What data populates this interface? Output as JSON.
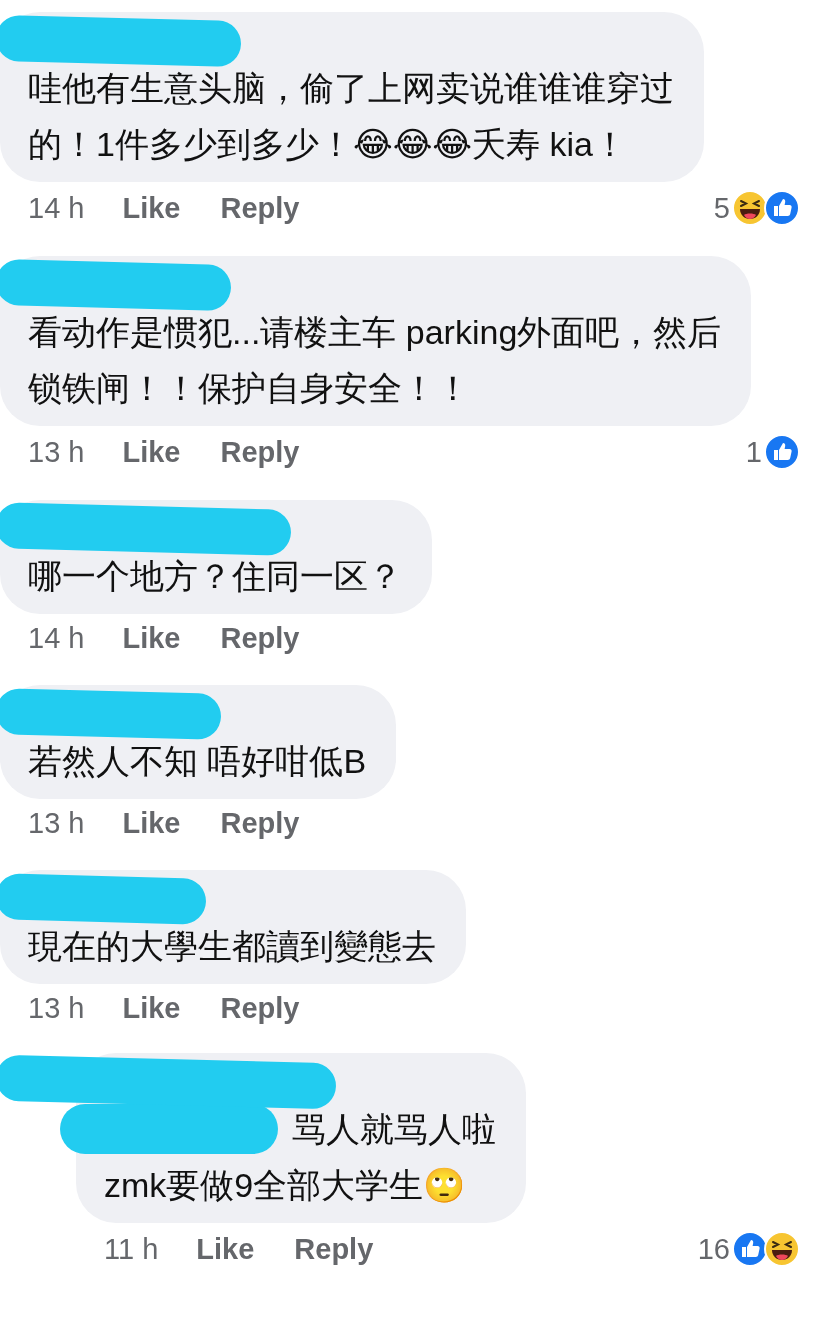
{
  "comments": [
    {
      "kind": "comment",
      "lines": [
        "哇他有生意头脑，偷了上网卖说谁谁谁穿过",
        "的！1件多少到多少！😂😂😂夭寿 kia！"
      ],
      "time": "14 h",
      "like": "Like",
      "reply": "Reply",
      "reaction_count": "5",
      "reactions": [
        {
          "kind": "haha"
        },
        {
          "kind": "like"
        }
      ]
    },
    {
      "kind": "comment",
      "lines": [
        "看动作是惯犯...请楼主车 parking外面吧，然后",
        "锁铁闸！！保护自身安全！！"
      ],
      "time": "13 h",
      "like": "Like",
      "reply": "Reply",
      "reaction_count": "1",
      "reactions": [
        {
          "kind": "like"
        }
      ]
    },
    {
      "kind": "comment",
      "lines": [
        "哪一个地方？住同一区？"
      ],
      "time": "14 h",
      "like": "Like",
      "reply": "Reply"
    },
    {
      "kind": "comment",
      "lines": [
        "若然人不知 唔好咁低B"
      ],
      "time": "13 h",
      "like": "Like",
      "reply": "Reply"
    },
    {
      "kind": "comment",
      "lines": [
        "現在的大學生都讀到變態去"
      ],
      "time": "13 h",
      "like": "Like",
      "reply": "Reply"
    },
    {
      "kind": "reply",
      "mention_hidden": true,
      "lines": [
        "骂人就骂人啦",
        "zmk要做9全部大学生🙄"
      ],
      "time": "11 h",
      "like": "Like",
      "reply": "Reply",
      "reaction_count": "16",
      "reactions": [
        {
          "kind": "like"
        },
        {
          "kind": "haha"
        }
      ]
    }
  ]
}
